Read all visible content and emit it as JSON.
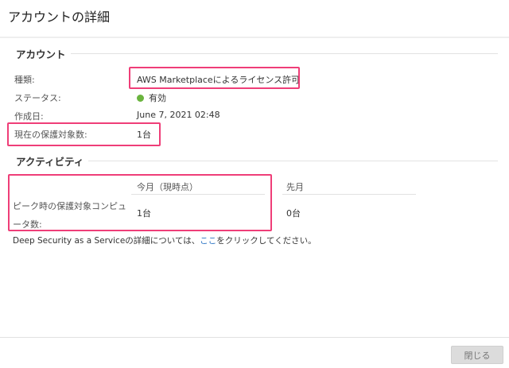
{
  "dialog_title": "アカウントの詳細",
  "account": {
    "heading": "アカウント",
    "type_label": "種類:",
    "type_value": "AWS Marketplaceによるライセンス許可",
    "status_label": "ステータス:",
    "status_value": "有効",
    "status_color": "#6ab43e",
    "created_label": "作成日:",
    "created_value": "June 7, 2021 02:48",
    "protected_label": "現在の保護対象数:",
    "protected_value": "1台"
  },
  "activity": {
    "heading": "アクティビティ",
    "col_this_month": "今月（現時点）",
    "col_last_month": "先月",
    "row_label": "ピーク時の保護対象コンピュータ数:",
    "this_month_value": "1台",
    "last_month_value": "0台"
  },
  "footer_text": {
    "before": "Deep Security as a Serviceの詳細については、",
    "link": "ここ",
    "after": "をクリックしてください。"
  },
  "close_button": "閉じる",
  "highlight_color": "#ef3e78"
}
